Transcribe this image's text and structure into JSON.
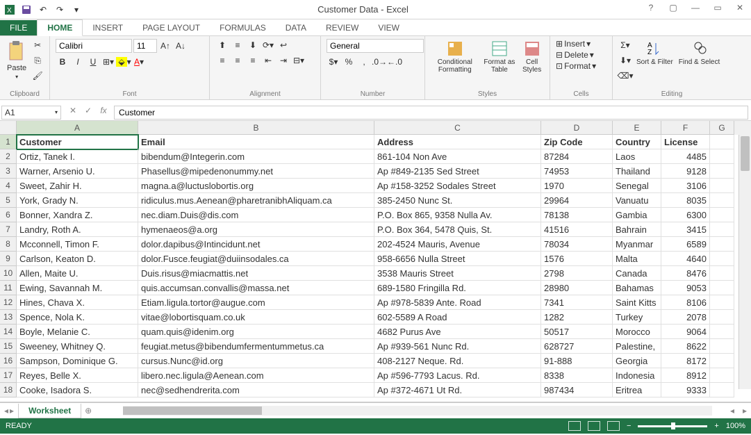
{
  "title": "Customer Data - Excel",
  "qat_icons": [
    "excel-icon",
    "save-icon",
    "undo-icon",
    "redo-icon",
    "customize-icon"
  ],
  "window_controls": [
    "help",
    "ribbon-options",
    "minimize",
    "restore",
    "close"
  ],
  "tabs": [
    "FILE",
    "HOME",
    "INSERT",
    "PAGE LAYOUT",
    "FORMULAS",
    "DATA",
    "REVIEW",
    "VIEW"
  ],
  "active_tab": "HOME",
  "ribbon": {
    "clipboard": {
      "label": "Clipboard",
      "paste": "Paste"
    },
    "font": {
      "label": "Font",
      "family": "Calibri",
      "size": "11",
      "buttons": {
        "bold": "B",
        "italic": "I",
        "underline": "U"
      }
    },
    "alignment": {
      "label": "Alignment"
    },
    "number": {
      "label": "Number",
      "format": "General"
    },
    "styles": {
      "label": "Styles",
      "conditional": "Conditional Formatting",
      "table": "Format as Table",
      "cell": "Cell Styles"
    },
    "cells": {
      "label": "Cells",
      "insert": "Insert",
      "delete": "Delete",
      "format": "Format"
    },
    "editing": {
      "label": "Editing",
      "sort": "Sort & Filter",
      "find": "Find & Select"
    }
  },
  "name_box": "A1",
  "formula_value": "Customer",
  "columns": [
    "A",
    "B",
    "C",
    "D",
    "E",
    "F",
    "G"
  ],
  "headers": [
    "Customer",
    "Email",
    "Address",
    "Zip Code",
    "Country",
    "License"
  ],
  "chart_data": {
    "type": "table",
    "columns": [
      "Customer",
      "Email",
      "Address",
      "Zip Code",
      "Country",
      "License"
    ],
    "rows": [
      [
        "Ortiz, Tanek I.",
        "bibendum@Integerin.com",
        "861-104 Non Ave",
        "87284",
        "Laos",
        4485
      ],
      [
        "Warner, Arsenio U.",
        "Phasellus@mipedenonummy.net",
        "Ap #849-2135 Sed Street",
        "74953",
        "Thailand",
        9128
      ],
      [
        "Sweet, Zahir H.",
        "magna.a@luctuslobortis.org",
        "Ap #158-3252 Sodales Street",
        "1970",
        "Senegal",
        3106
      ],
      [
        "York, Grady N.",
        "ridiculus.mus.Aenean@pharetranibhAliquam.ca",
        "385-2450 Nunc St.",
        "29964",
        "Vanuatu",
        8035
      ],
      [
        "Bonner, Xandra Z.",
        "nec.diam.Duis@dis.com",
        "P.O. Box 865, 9358 Nulla Av.",
        "78138",
        "Gambia",
        6300
      ],
      [
        "Landry, Roth A.",
        "hymenaeos@a.org",
        "P.O. Box 364, 5478 Quis, St.",
        "41516",
        "Bahrain",
        3415
      ],
      [
        "Mcconnell, Timon F.",
        "dolor.dapibus@Intincidunt.net",
        "202-4524 Mauris, Avenue",
        "78034",
        "Myanmar",
        6589
      ],
      [
        "Carlson, Keaton D.",
        "dolor.Fusce.feugiat@duiinsodales.ca",
        "958-6656 Nulla Street",
        "1576",
        "Malta",
        4640
      ],
      [
        "Allen, Maite U.",
        "Duis.risus@miacmattis.net",
        "3538 Mauris Street",
        "2798",
        "Canada",
        8476
      ],
      [
        "Ewing, Savannah M.",
        "quis.accumsan.convallis@massa.net",
        "689-1580 Fringilla Rd.",
        "28980",
        "Bahamas",
        9053
      ],
      [
        "Hines, Chava X.",
        "Etiam.ligula.tortor@augue.com",
        "Ap #978-5839 Ante. Road",
        "7341",
        "Saint Kitts",
        8106
      ],
      [
        "Spence, Nola K.",
        "vitae@lobortisquam.co.uk",
        "602-5589 A Road",
        "1282",
        "Turkey",
        2078
      ],
      [
        "Boyle, Melanie C.",
        "quam.quis@idenim.org",
        "4682 Purus Ave",
        "50517",
        "Morocco",
        9064
      ],
      [
        "Sweeney, Whitney Q.",
        "feugiat.metus@bibendumfermentummetus.ca",
        "Ap #939-561 Nunc Rd.",
        "628727",
        "Palestine,",
        8622
      ],
      [
        "Sampson, Dominique G.",
        "cursus.Nunc@id.org",
        "408-2127 Neque. Rd.",
        "91-888",
        "Georgia",
        8172
      ],
      [
        "Reyes, Belle X.",
        "libero.nec.ligula@Aenean.com",
        "Ap #596-7793 Lacus. Rd.",
        "8338",
        "Indonesia",
        8912
      ],
      [
        "Cooke, Isadora S.",
        "nec@sedhendrerita.com",
        "Ap #372-4671 Ut Rd.",
        "987434",
        "Eritrea",
        9333
      ]
    ]
  },
  "sheet_name": "Worksheet",
  "status": "READY",
  "zoom": "100%"
}
